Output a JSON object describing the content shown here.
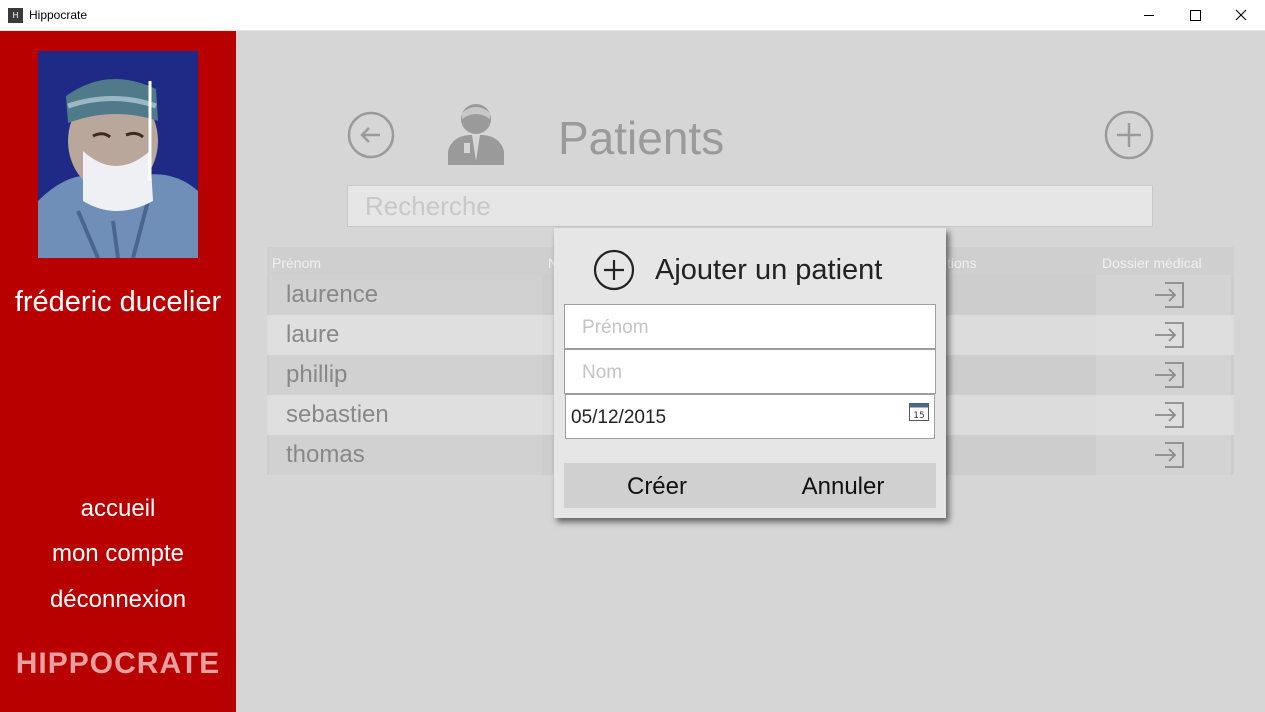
{
  "window": {
    "icon_text": "H",
    "title": "Hippocrate"
  },
  "sidebar": {
    "user_name": "fréderic ducelier",
    "nav": [
      "accueil",
      "mon compte",
      "déconnexion"
    ],
    "brand": "HIPPOCRATE",
    "color": "#b90000"
  },
  "main": {
    "title": "Patients",
    "search": {
      "placeholder": "Recherche"
    },
    "table": {
      "headers": [
        "Prénom",
        "N",
        "tions",
        "Dossier médical"
      ],
      "rows": [
        "laurence",
        "laure",
        "phillip",
        "sebastien",
        "thomas"
      ]
    }
  },
  "dialog": {
    "title": "Ajouter un patient",
    "prenom_placeholder": "Prénom",
    "nom_placeholder": "Nom",
    "date_value": "05/12/2015",
    "calendar_day": "15",
    "create_label": "Créer",
    "cancel_label": "Annuler"
  }
}
